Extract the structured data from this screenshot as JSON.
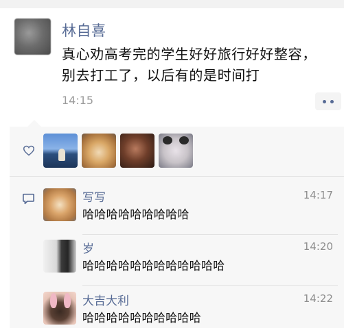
{
  "post": {
    "author": "林自喜",
    "text": "真心劝高考完的学生好好旅行好好整容，别去打工了，以后有的是时间打",
    "time": "14:15",
    "more_icon": "ellipsis-icon"
  },
  "likes": {
    "icon": "heart-outline-icon",
    "avatars": [
      "liker-avatar-1",
      "liker-avatar-2",
      "liker-avatar-3",
      "liker-avatar-4"
    ]
  },
  "comments": {
    "icon": "comment-bubble-icon",
    "items": [
      {
        "name": "写写",
        "time": "14:17",
        "text": "哈哈哈哈哈哈哈哈哈"
      },
      {
        "name": "岁",
        "time": "14:20",
        "text": "哈哈哈哈哈哈哈哈哈哈哈哈"
      },
      {
        "name": "大吉大利",
        "time": "14:22",
        "text": "哈哈哈哈哈哈哈哈哈哈"
      }
    ]
  },
  "colors": {
    "link_blue": "#576b95",
    "text_dark": "#111111",
    "time_gray": "#9b9b9b",
    "panel_bg": "#f7f7f7"
  }
}
